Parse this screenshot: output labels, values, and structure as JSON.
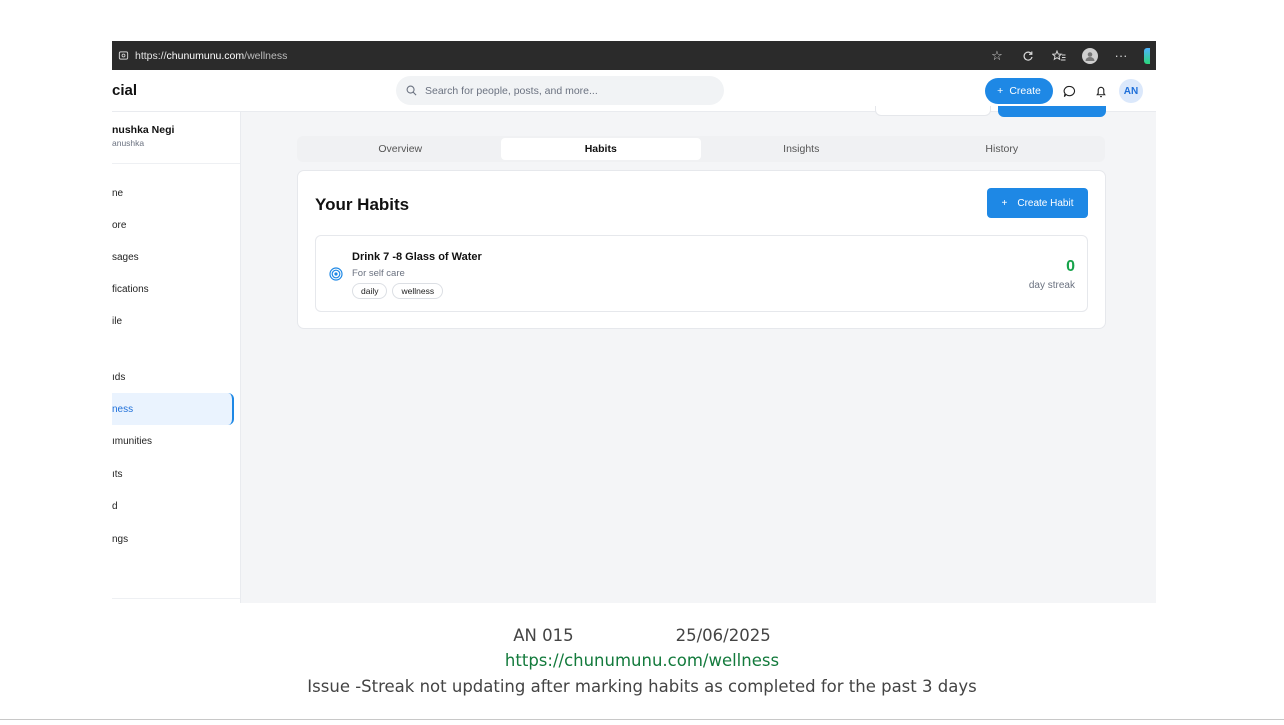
{
  "browser": {
    "url_scheme": "https://",
    "url_host": "chunumunu.com",
    "url_path": "/wellness"
  },
  "app": {
    "brand": "cial",
    "search_placeholder": "Search for people, posts, and more...",
    "create_label": "Create",
    "avatar_initials": "AN"
  },
  "sidebar": {
    "user_name": "nushka Negi",
    "user_handle": "anushka",
    "items": [
      {
        "label": "ne"
      },
      {
        "label": "ore"
      },
      {
        "label": "sages"
      },
      {
        "label": "fications"
      },
      {
        "label": "ile"
      },
      {
        "label": "ıds"
      },
      {
        "label": "ness",
        "active": true
      },
      {
        "label": "ımunities"
      },
      {
        "label": "ıts"
      },
      {
        "label": "d"
      },
      {
        "label": "ngs"
      }
    ]
  },
  "tabs": [
    {
      "label": "Overview"
    },
    {
      "label": "Habits",
      "active": true
    },
    {
      "label": "Insights"
    },
    {
      "label": "History"
    }
  ],
  "habits": {
    "title": "Your Habits",
    "create_label": "Create Habit",
    "items": [
      {
        "name": "Drink 7 -8 Glass of Water",
        "description": "For self care",
        "tags": [
          "daily",
          "wellness"
        ],
        "streak": "0",
        "streak_label": "day streak"
      }
    ]
  },
  "caption": {
    "id": "AN 015",
    "date": "25/06/2025",
    "url": "https://chunumunu.com/wellness",
    "issue": "Issue -Streak not updating after marking habits as completed for the past 3 days"
  },
  "colors": {
    "accent": "#1e88e5",
    "streak": "#16a34a",
    "link": "#137a3c"
  }
}
